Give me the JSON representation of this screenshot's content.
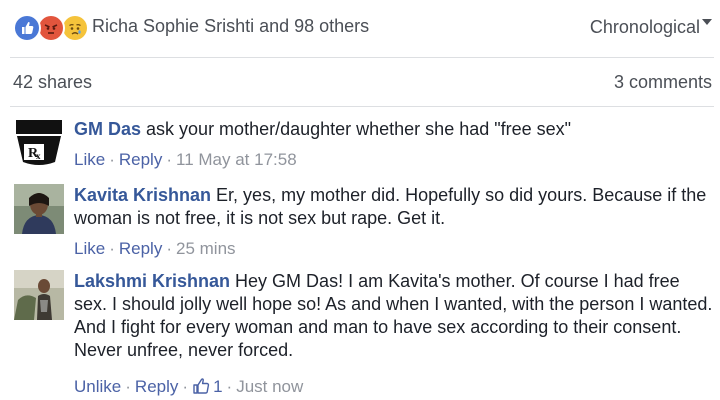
{
  "reactions": {
    "icons": [
      "like-icon",
      "angry-icon",
      "sad-icon"
    ],
    "names": "Richa Sophie Srishti and 98 others",
    "colors": {
      "like": "#4a78d6",
      "angry": "#e2553d",
      "sad": "#f5c33b"
    }
  },
  "sort": {
    "selected": "Chronological"
  },
  "stats": {
    "shares": "42 shares",
    "comments": "3 comments"
  },
  "comments": [
    {
      "author": "GM Das",
      "text": " ask your mother/daughter whether she had \"free sex\"",
      "like_label": "Like",
      "reply_label": "Reply",
      "time": "11 May at 17:58"
    },
    {
      "author": "Kavita Krishnan",
      "text": " Er, yes, my mother did. Hopefully so did yours. Because if the woman is not free, it is not sex but rape. Get it.",
      "like_label": "Like",
      "reply_label": "Reply",
      "time": "25 mins"
    },
    {
      "author": "Lakshmi Krishnan",
      "text": " Hey GM Das! I am Kavita's mother. Of course I had free sex. I should jolly well hope so! As and when I wanted, with the person I wanted. And I fight for every woman and man to have sex according to their consent. Never unfree, never forced.",
      "like_label": "Unlike",
      "reply_label": "Reply",
      "like_count": "1",
      "time": "Just now"
    }
  ],
  "separator": "·"
}
